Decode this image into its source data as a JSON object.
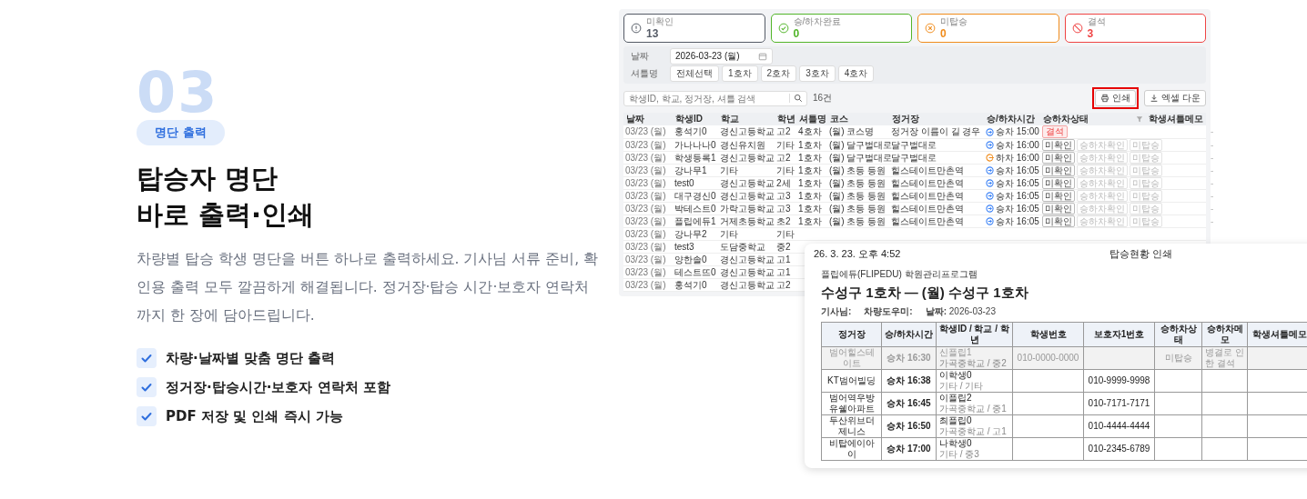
{
  "hero": {
    "number": "03",
    "badge": "명단 출력",
    "title_lines": [
      "탑승자 명단",
      "바로 출력·인쇄"
    ],
    "description": "차량별 탑승 학생 명단을 버튼 하나로 출력하세요. 기사님 서류 준비, 확인용 출력 모두 깔끔하게 해결됩니다. 정거장·탑승 시간·보호자 연락처까지 한 장에 담아드립니다.",
    "features": [
      "차량·날짜별 맞춤 명단 출력",
      "정거장·탑승시간·보호자 연락처 포함",
      "PDF 저장 및 인쇄 즉시 가능"
    ]
  },
  "app": {
    "stats": [
      {
        "kind": "pending",
        "label": "미확인",
        "value": "13",
        "color": "#555b66"
      },
      {
        "kind": "done",
        "label": "승/하차완료",
        "value": "0",
        "color": "#52b52a"
      },
      {
        "kind": "missed",
        "label": "미탑승",
        "value": "0",
        "color": "#f08c1c"
      },
      {
        "kind": "absent",
        "label": "결석",
        "value": "3",
        "color": "#ef4444"
      }
    ],
    "filters": {
      "date_label": "날짜",
      "date": "2026-03-23 (월)",
      "shuttle_label": "셔틀명",
      "shuttles": [
        {
          "label": "전체선택",
          "selected": false
        },
        {
          "label": "1호차",
          "selected": false
        },
        {
          "label": "2호차",
          "selected": false
        },
        {
          "label": "3호차",
          "selected": false
        },
        {
          "label": "4호차",
          "selected": false
        }
      ]
    },
    "search": {
      "placeholder": "학생ID, 학교, 정거장, 셔틀 검색",
      "count": "16건"
    },
    "toolbar": {
      "print": {
        "label": "인쇄",
        "highlighted": true
      },
      "excel": {
        "label": "엑셀 다운"
      }
    },
    "table": {
      "columns": [
        "날짜",
        "학생ID",
        "학교",
        "학년",
        "셔틀명",
        "코스",
        "정거장",
        "승/하차시간",
        "승하차상태",
        "학생셔틀메모"
      ],
      "rows": [
        {
          "date": "03/23 (월)",
          "id": "홍석기0",
          "school": "경신고등학교",
          "grade": "고2",
          "shuttle": "4호차",
          "course": "(월) 코스명",
          "stop": "정거장 이름이 길 경우",
          "time": {
            "kind": "board",
            "text": "승차 15:00"
          },
          "status": {
            "kind": "badge",
            "label": "결석"
          },
          "memo": "-"
        },
        {
          "date": "03/23 (월)",
          "id": "가나나나0",
          "school": "경신유치원",
          "grade": "기타",
          "shuttle": "1호차",
          "course": "(월) 달구벌대로",
          "stop": "달구벌대로",
          "time": {
            "kind": "board",
            "text": "승차 16:00"
          },
          "status": {
            "kind": "buttons",
            "buttons": [
              {
                "label": "미확인",
                "selected": true
              },
              {
                "label": "승하차확인",
                "selected": false
              },
              {
                "label": "미탑승",
                "selected": false
              }
            ]
          },
          "memo": "-"
        },
        {
          "date": "03/23 (월)",
          "id": "학생등록1",
          "school": "경신고등학교",
          "grade": "고2",
          "shuttle": "1호차",
          "course": "(월) 달구벌대로",
          "stop": "달구벌대로",
          "time": {
            "kind": "alight",
            "text": "하차 16:00"
          },
          "status": {
            "kind": "buttons",
            "buttons": [
              {
                "label": "미확인",
                "selected": true
              },
              {
                "label": "승하차확인",
                "selected": false
              },
              {
                "label": "미탑승",
                "selected": false
              }
            ]
          },
          "memo": "-"
        },
        {
          "date": "03/23 (월)",
          "id": "강나무1",
          "school": "기타",
          "grade": "기타",
          "shuttle": "1호차",
          "course": "(월) 초등 등원",
          "stop": "힐스테이트만촌역",
          "time": {
            "kind": "board",
            "text": "승차 16:05"
          },
          "status": {
            "kind": "buttons",
            "buttons": [
              {
                "label": "미확인",
                "selected": true
              },
              {
                "label": "승하차확인",
                "selected": false
              },
              {
                "label": "미탑승",
                "selected": false
              }
            ]
          },
          "memo": "-"
        },
        {
          "date": "03/23 (월)",
          "id": "test0",
          "school": "경신고등학교",
          "grade": "2세",
          "shuttle": "1호차",
          "course": "(월) 초등 등원",
          "stop": "힐스테이트만촌역",
          "time": {
            "kind": "board",
            "text": "승차 16:05"
          },
          "status": {
            "kind": "buttons",
            "buttons": [
              {
                "label": "미확인",
                "selected": true
              },
              {
                "label": "승하차확인",
                "selected": false
              },
              {
                "label": "미탑승",
                "selected": false
              }
            ]
          },
          "memo": "-"
        },
        {
          "date": "03/23 (월)",
          "id": "대구경신0",
          "school": "경신고등학교",
          "grade": "고3",
          "shuttle": "1호차",
          "course": "(월) 초등 등원",
          "stop": "힐스테이트만촌역",
          "time": {
            "kind": "board",
            "text": "승차 16:05"
          },
          "status": {
            "kind": "buttons",
            "buttons": [
              {
                "label": "미확인",
                "selected": true
              },
              {
                "label": "승하차확인",
                "selected": false
              },
              {
                "label": "미탑승",
                "selected": false
              }
            ]
          },
          "memo": "-"
        },
        {
          "date": "03/23 (월)",
          "id": "박테스트0",
          "school": "가락고등학교",
          "grade": "고3",
          "shuttle": "1호차",
          "course": "(월) 초등 등원",
          "stop": "힐스테이트만촌역",
          "time": {
            "kind": "board",
            "text": "승차 16:05"
          },
          "status": {
            "kind": "buttons",
            "buttons": [
              {
                "label": "미확인",
                "selected": true
              },
              {
                "label": "승하차확인",
                "selected": false
              },
              {
                "label": "미탑승",
                "selected": false
              }
            ]
          },
          "memo": "-"
        },
        {
          "date": "03/23 (월)",
          "id": "플립에듀1",
          "school": "거제초등학교",
          "grade": "초2",
          "shuttle": "1호차",
          "course": "(월) 초등 등원",
          "stop": "힐스테이트만촌역",
          "time": {
            "kind": "board",
            "text": "승차 16:05"
          },
          "status": {
            "kind": "buttons",
            "buttons": [
              {
                "label": "미확인",
                "selected": true
              },
              {
                "label": "승하차확인",
                "selected": false
              },
              {
                "label": "미탑승",
                "selected": false
              }
            ]
          },
          "memo": "-"
        },
        {
          "date": "03/23 (월)",
          "id": "강나무2",
          "school": "기타",
          "grade": "기타"
        },
        {
          "date": "03/23 (월)",
          "id": "test3",
          "school": "도담중학교",
          "grade": "중2"
        },
        {
          "date": "03/23 (월)",
          "id": "양한솔0",
          "school": "경신고등학교",
          "grade": "고1"
        },
        {
          "date": "03/23 (월)",
          "id": "테스트뜨0",
          "school": "경신고등학교",
          "grade": "고1"
        },
        {
          "date": "03/23 (월)",
          "id": "홍석기0",
          "school": "경신고등학교",
          "grade": "고2"
        }
      ]
    }
  },
  "print_preview": {
    "timestamp": "26. 3. 23. 오후 4:52",
    "page_title": "탑승현황 인쇄",
    "brand": "플립에듀(FLIPEDU) 학원관리프로그램",
    "title": "수성구 1호차 — (월) 수성구 1호차",
    "info": [
      {
        "label": "기사님:"
      },
      {
        "label": "차량도우미:"
      },
      {
        "label": "날짜:",
        "value": "2026-03-23"
      }
    ],
    "columns": [
      "정거장",
      "승/하차시간",
      "학생ID / 학교 / 학년",
      "학생번호",
      "보호자1번호",
      "승하차상태",
      "승하차메모",
      "학생셔틀메모"
    ],
    "rows": [
      {
        "muted": true,
        "stop": "범어힐스테이트",
        "time": "승차 16:30",
        "student": "신플립1",
        "school_grade": "가곡중학교 / 중2",
        "student_phone": "010-0000-0000",
        "status": "미탑승",
        "memo": "병결로 인한 결석"
      },
      {
        "muted": false,
        "stop": "KT범어빌딩",
        "time": "승차 16:38",
        "student": "이학생0",
        "school_grade": "기타 / 기타",
        "guardian_phone": "010-9999-9998"
      },
      {
        "muted": false,
        "stop": "범어역우방유쉘아파트",
        "time": "승차 16:45",
        "student": "이플립2",
        "school_grade": "가곡중학교 / 중1",
        "guardian_phone": "010-7171-7171"
      },
      {
        "muted": false,
        "stop": "두산위브더제니스",
        "time": "승차 16:50",
        "student": "최플립0",
        "school_grade": "가곡중학교 / 고1",
        "guardian_phone": "010-4444-4444"
      },
      {
        "muted": false,
        "stop": "비탑에이아이",
        "time": "승차 17:00",
        "student": "나학생0",
        "school_grade": "기타 / 중3",
        "guardian_phone": "010-2345-6789"
      }
    ]
  }
}
